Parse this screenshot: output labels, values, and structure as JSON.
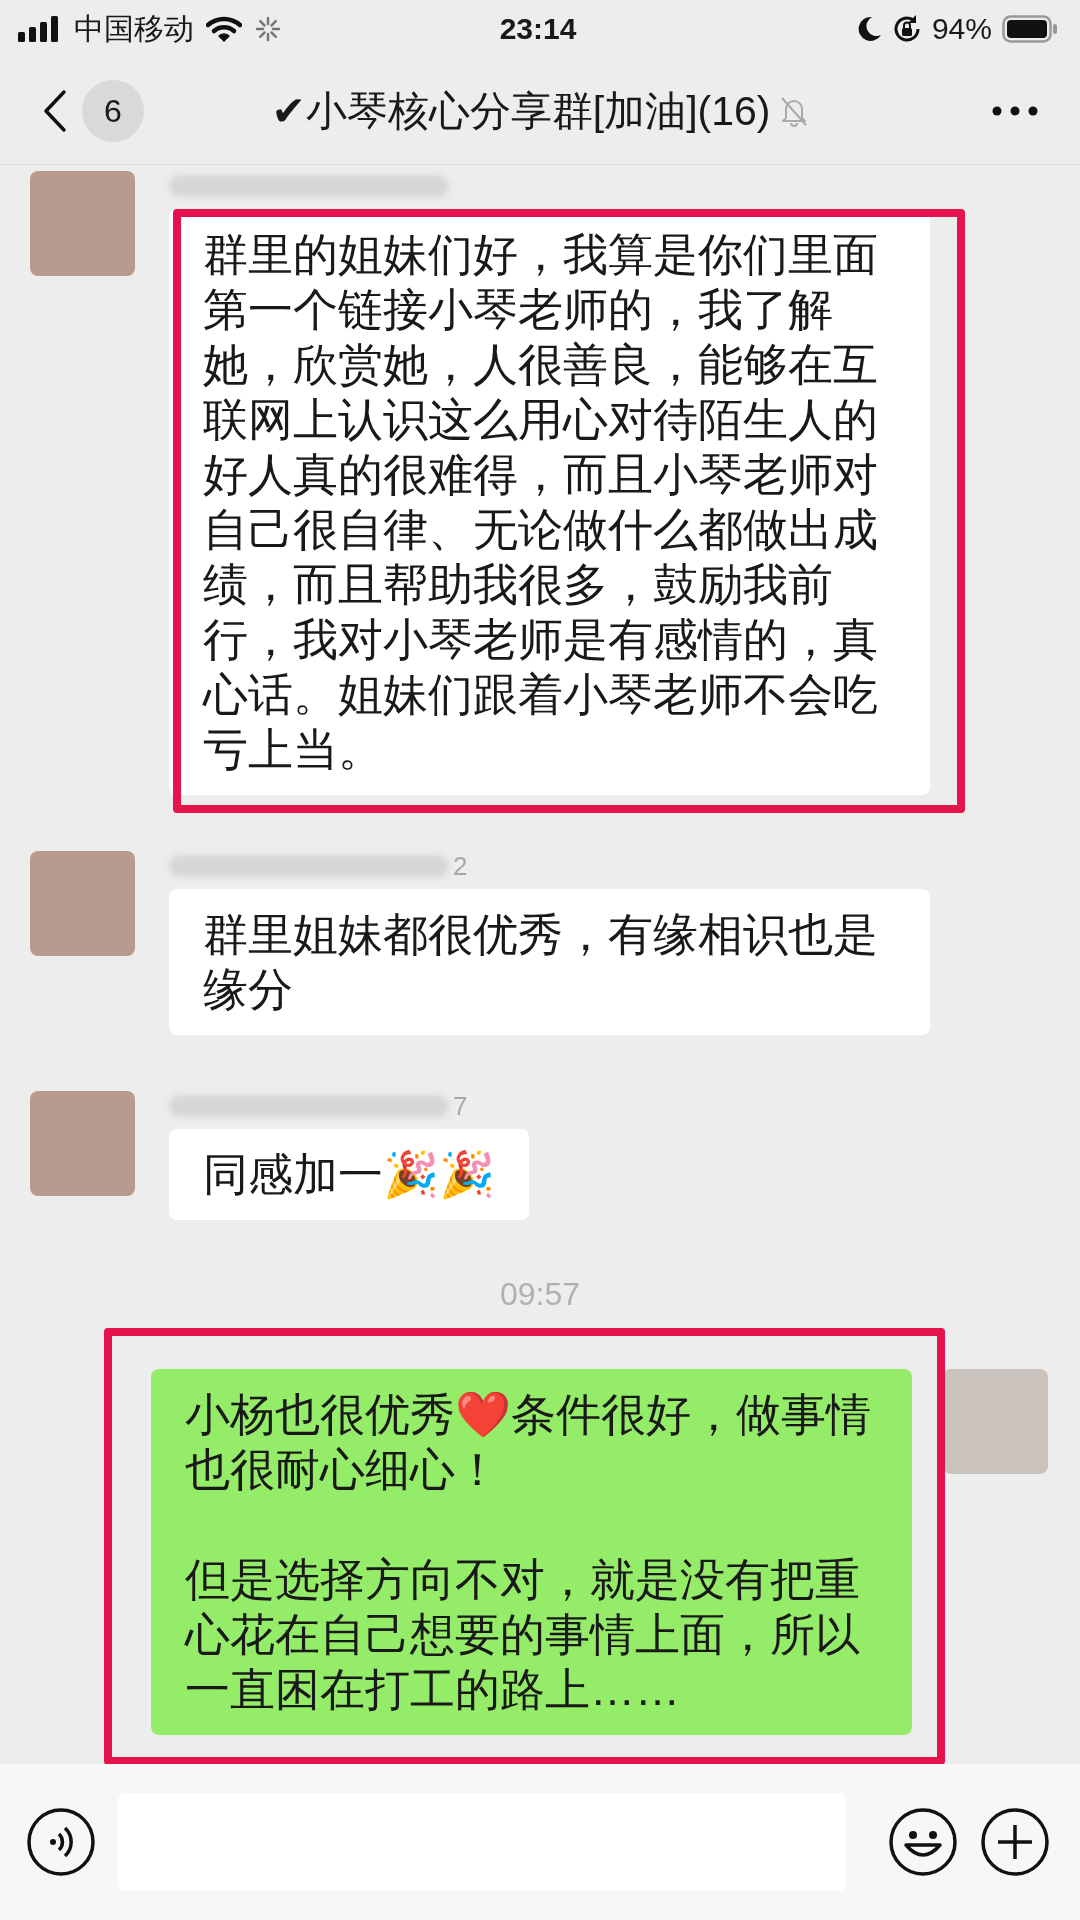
{
  "status_bar": {
    "carrier": "中国移动",
    "time": "23:14",
    "battery": "94%"
  },
  "header": {
    "unread_count": "6",
    "title": "✔小琴核心分享群[加油](16)",
    "muted": true
  },
  "messages": [
    {
      "kind": "incoming",
      "highlighted": true,
      "text": "群里的姐妹们好，我算是你们里面第一个链接小琴老师的，我了解她，欣赏她，人很善良，能够在互联网上认识这么用心对待陌生人的好人真的很难得，而且小琴老师对自己很自律、无论做什么都做出成绩，而且帮助我很多，鼓励我前行，我对小琴老师是有感情的，真心话。姐妹们跟着小琴老师不会吃亏上当。"
    },
    {
      "kind": "incoming",
      "highlighted": false,
      "name_tail": "2",
      "text": "群里姐妹都很优秀，有缘相识也是缘分"
    },
    {
      "kind": "incoming",
      "highlighted": false,
      "name_tail": "7",
      "text": "同感加一🎉🎉"
    },
    {
      "kind": "time",
      "text": "09:57"
    },
    {
      "kind": "outgoing",
      "highlighted": true,
      "paragraphs": [
        "小杨也很优秀❤️条件很好，做事情也很耐心细心！",
        "但是选择方向不对，就是没有把重心花在自己想要的事情上面，所以一直困在打工的路上……"
      ]
    }
  ]
}
